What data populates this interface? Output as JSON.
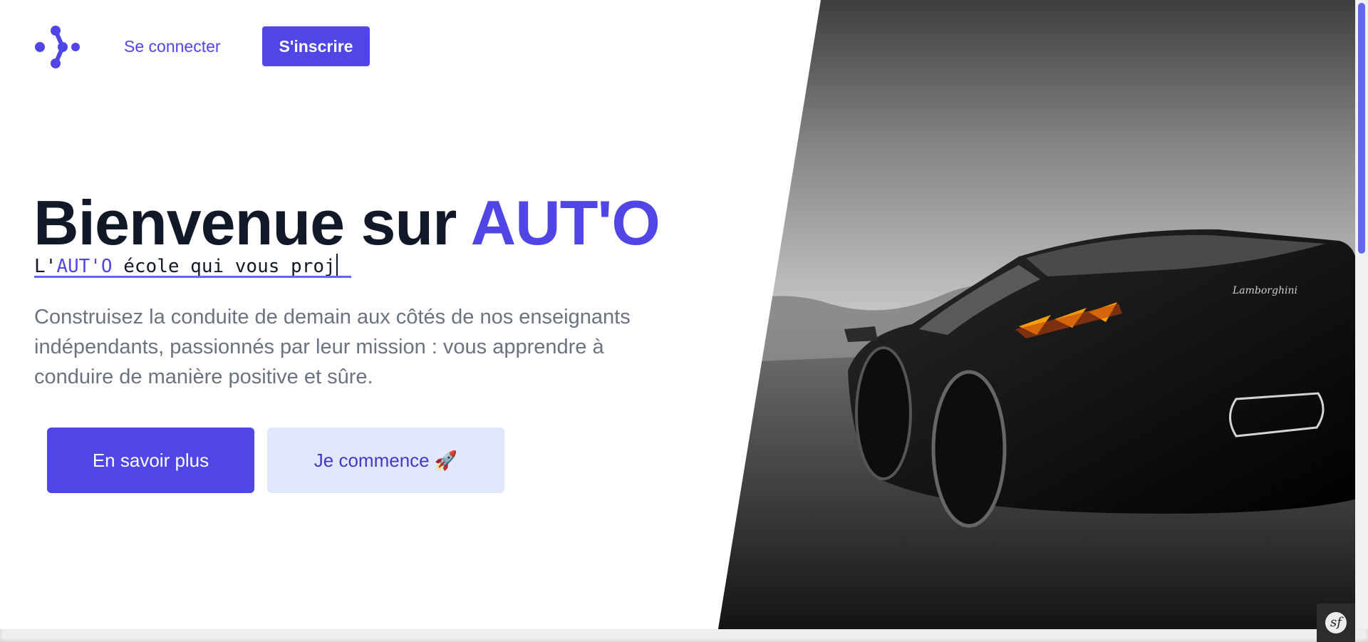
{
  "header": {
    "login_label": "Se connecter",
    "signup_label": "S'inscrire"
  },
  "hero": {
    "title_prefix": "Bienvenue sur ",
    "title_brand": "AUT'O",
    "typed": {
      "prefix": "L'",
      "link": "AUT'O",
      "suffix": " école qui vous proj"
    },
    "description": "Construisez la conduite de demain aux côtés de nos enseignants indépendants, passionnés par leur mission : vous apprendre à conduire de manière positive et sûre.",
    "primary_button": "En savoir plus",
    "secondary_button": "Je commence 🚀"
  },
  "toolbar": {
    "toggle_label": "sf"
  },
  "colors": {
    "accent": "#4f46e5",
    "accent_light": "#e0e7ff",
    "heading": "#111827",
    "body_text": "#6b7280"
  },
  "icons": {
    "logo": "dots-logo-icon",
    "start": "rocket-icon",
    "debug": "symfony-icon"
  },
  "scroll": {
    "thumb_fraction": 0.4
  }
}
